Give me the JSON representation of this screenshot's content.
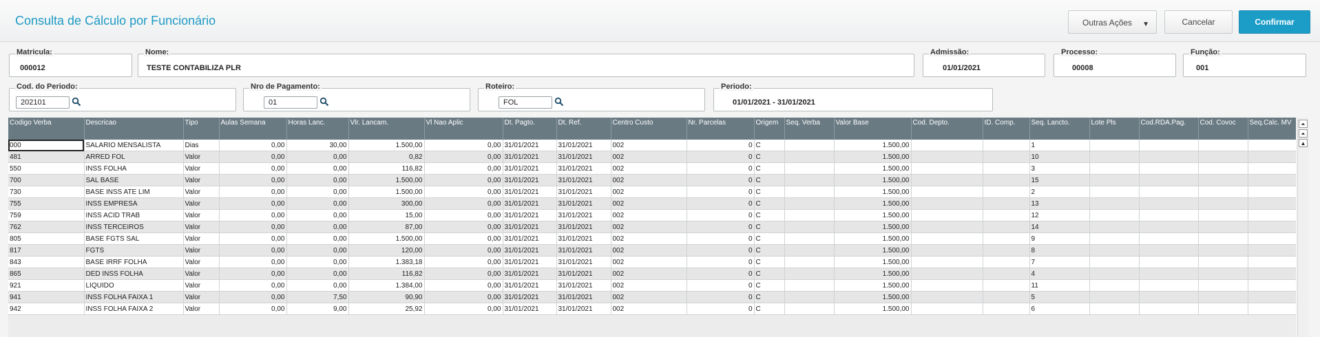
{
  "header": {
    "title": "Consulta de Cálculo por Funcionário",
    "outras_acoes": "Outras Ações",
    "cancelar": "Cancelar",
    "confirmar": "Confirmar"
  },
  "fields": {
    "matricula": {
      "label": "Matricula:",
      "value": "000012"
    },
    "nome": {
      "label": "Nome:",
      "value": "TESTE CONTABILIZA PLR"
    },
    "admissao": {
      "label": "Admissão:",
      "value": "01/01/2021"
    },
    "processo": {
      "label": "Processo:",
      "value": "00008"
    },
    "funcao": {
      "label": "Função:",
      "value": "001"
    },
    "cod_periodo": {
      "label": "Cod. do Periodo:",
      "value": "202101"
    },
    "nro_pagamento": {
      "label": "Nro de Pagamento:",
      "value": "01"
    },
    "roteiro": {
      "label": "Roteiro:",
      "value": "FOL"
    },
    "periodo": {
      "label": "Periodo:",
      "value": "01/01/2021 - 31/01/2021"
    }
  },
  "grid": {
    "columns": [
      "Codigo Verba",
      "Descricao",
      "Tipo",
      "Aulas Semana",
      "Horas Lanc.",
      "Vlr. Lancam.",
      "Vl Nao Aplic",
      "Dt. Pagto.",
      "Dt. Ref.",
      "Centro Custo",
      "Nr. Parcelas",
      "Origem",
      "Seq. Verba",
      "Valor Base",
      "Cod. Depto.",
      "ID. Comp.",
      "Seq. Lancto.",
      "Lote Pls",
      "Cod.RDA.Pag.",
      "Cod. Covoc",
      "Seq.Calc. MV"
    ],
    "rows": [
      [
        "000",
        "SALARIO MENSALISTA",
        "Dias",
        "0,00",
        "30,00",
        "1.500,00",
        "0,00",
        "31/01/2021",
        "31/01/2021",
        "002",
        "0",
        "C",
        "",
        "1.500,00",
        "",
        "",
        "1",
        "",
        "",
        "",
        ""
      ],
      [
        "481",
        "ARRED FOL",
        "Valor",
        "0,00",
        "0,00",
        "0,82",
        "0,00",
        "31/01/2021",
        "31/01/2021",
        "002",
        "0",
        "C",
        "",
        "1.500,00",
        "",
        "",
        "10",
        "",
        "",
        "",
        ""
      ],
      [
        "550",
        "INSS FOLHA",
        "Valor",
        "0,00",
        "0,00",
        "116,82",
        "0,00",
        "31/01/2021",
        "31/01/2021",
        "002",
        "0",
        "C",
        "",
        "1.500,00",
        "",
        "",
        "3",
        "",
        "",
        "",
        ""
      ],
      [
        "700",
        "SAL BASE",
        "Valor",
        "0,00",
        "0,00",
        "1.500,00",
        "0,00",
        "31/01/2021",
        "31/01/2021",
        "002",
        "0",
        "C",
        "",
        "1.500,00",
        "",
        "",
        "15",
        "",
        "",
        "",
        ""
      ],
      [
        "730",
        "BASE INSS ATE LIM",
        "Valor",
        "0,00",
        "0,00",
        "1.500,00",
        "0,00",
        "31/01/2021",
        "31/01/2021",
        "002",
        "0",
        "C",
        "",
        "1.500,00",
        "",
        "",
        "2",
        "",
        "",
        "",
        ""
      ],
      [
        "755",
        "INSS EMPRESA",
        "Valor",
        "0,00",
        "0,00",
        "300,00",
        "0,00",
        "31/01/2021",
        "31/01/2021",
        "002",
        "0",
        "C",
        "",
        "1.500,00",
        "",
        "",
        "13",
        "",
        "",
        "",
        ""
      ],
      [
        "759",
        "INSS ACID TRAB",
        "Valor",
        "0,00",
        "0,00",
        "15,00",
        "0,00",
        "31/01/2021",
        "31/01/2021",
        "002",
        "0",
        "C",
        "",
        "1.500,00",
        "",
        "",
        "12",
        "",
        "",
        "",
        ""
      ],
      [
        "762",
        "INSS TERCEIROS",
        "Valor",
        "0,00",
        "0,00",
        "87,00",
        "0,00",
        "31/01/2021",
        "31/01/2021",
        "002",
        "0",
        "C",
        "",
        "1.500,00",
        "",
        "",
        "14",
        "",
        "",
        "",
        ""
      ],
      [
        "805",
        "BASE FGTS SAL",
        "Valor",
        "0,00",
        "0,00",
        "1.500,00",
        "0,00",
        "31/01/2021",
        "31/01/2021",
        "002",
        "0",
        "C",
        "",
        "1.500,00",
        "",
        "",
        "9",
        "",
        "",
        "",
        ""
      ],
      [
        "817",
        "FGTS",
        "Valor",
        "0,00",
        "0,00",
        "120,00",
        "0,00",
        "31/01/2021",
        "31/01/2021",
        "002",
        "0",
        "C",
        "",
        "1.500,00",
        "",
        "",
        "8",
        "",
        "",
        "",
        ""
      ],
      [
        "843",
        "BASE IRRF FOLHA",
        "Valor",
        "0,00",
        "0,00",
        "1.383,18",
        "0,00",
        "31/01/2021",
        "31/01/2021",
        "002",
        "0",
        "C",
        "",
        "1.500,00",
        "",
        "",
        "7",
        "",
        "",
        "",
        ""
      ],
      [
        "865",
        "DED INSS FOLHA",
        "Valor",
        "0,00",
        "0,00",
        "116,82",
        "0,00",
        "31/01/2021",
        "31/01/2021",
        "002",
        "0",
        "C",
        "",
        "1.500,00",
        "",
        "",
        "4",
        "",
        "",
        "",
        ""
      ],
      [
        "921",
        "LIQUIDO",
        "Valor",
        "0,00",
        "0,00",
        "1.384,00",
        "0,00",
        "31/01/2021",
        "31/01/2021",
        "002",
        "0",
        "C",
        "",
        "1.500,00",
        "",
        "",
        "11",
        "",
        "",
        "",
        ""
      ],
      [
        "941",
        "INSS FOLHA FAIXA 1",
        "Valor",
        "0,00",
        "7,50",
        "90,90",
        "0,00",
        "31/01/2021",
        "31/01/2021",
        "002",
        "0",
        "C",
        "",
        "1.500,00",
        "",
        "",
        "5",
        "",
        "",
        "",
        ""
      ],
      [
        "942",
        "INSS FOLHA FAIXA 2",
        "Valor",
        "0,00",
        "9,00",
        "25,92",
        "0,00",
        "31/01/2021",
        "31/01/2021",
        "002",
        "0",
        "C",
        "",
        "1.500,00",
        "",
        "",
        "6",
        "",
        "",
        "",
        ""
      ]
    ]
  },
  "icons": {
    "search": "search-icon",
    "scroll_top": "scroll-top-icon",
    "scroll_up": "scroll-up-icon",
    "dropdown": "chevron-down-icon"
  }
}
